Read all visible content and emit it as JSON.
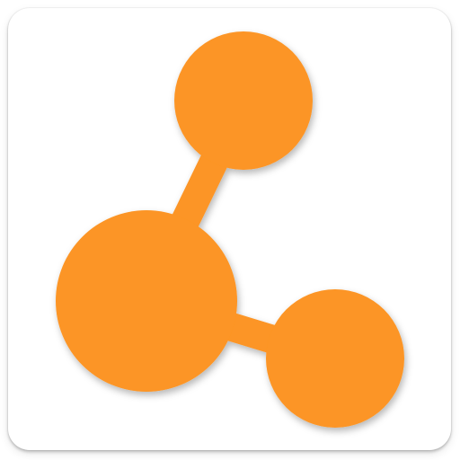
{
  "app_icon": {
    "icon": "share-nodes-icon",
    "colors": {
      "tile_background": "#ffffff",
      "node_fill": "#fc9525",
      "connector_fill": "#fc9525"
    }
  }
}
